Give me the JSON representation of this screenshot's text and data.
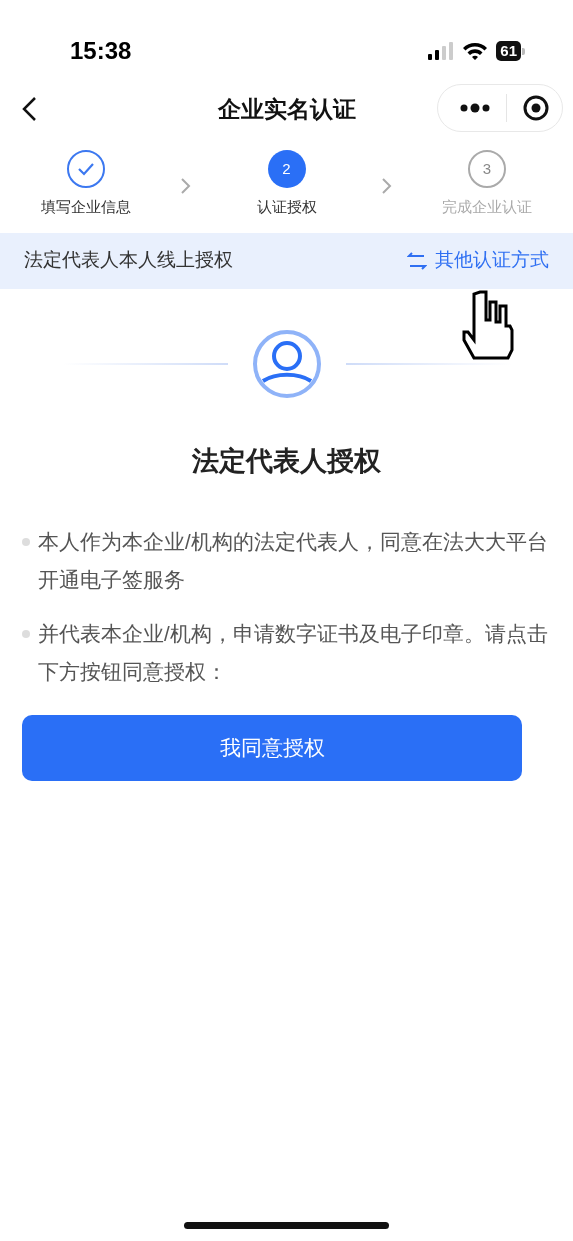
{
  "status_bar": {
    "time": "15:38",
    "battery": "61"
  },
  "nav": {
    "title": "企业实名认证"
  },
  "steps": [
    {
      "label": "填写企业信息",
      "done": true,
      "selected": false
    },
    {
      "number": "2",
      "label": "认证授权",
      "done": false,
      "selected": true
    },
    {
      "number": "3",
      "label": "完成企业认证",
      "done": false,
      "selected": false
    }
  ],
  "banner": {
    "text": "法定代表人本人线上授权",
    "link": "其他认证方式"
  },
  "heading": "法定代表人授权",
  "bullets": [
    "本人作为本企业/机构的法定代表人，同意在法大大平台开通电子签服务",
    "并代表本企业/机构，申请数字证书及电子印章。请点击下方按钮同意授权："
  ],
  "button": "我同意授权"
}
